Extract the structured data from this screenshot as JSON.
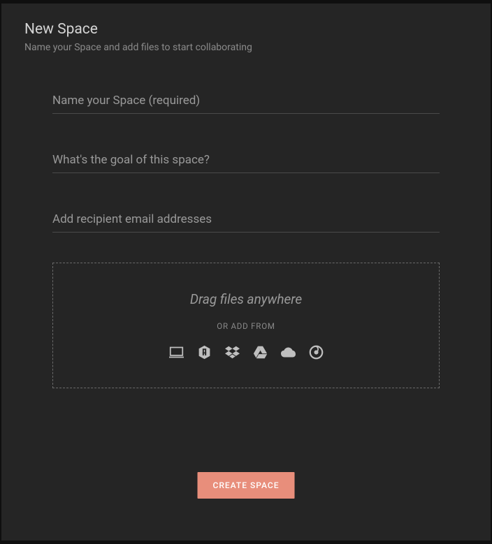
{
  "header": {
    "title": "New Space",
    "subtitle": "Name your Space and add files to start collaborating"
  },
  "form": {
    "name_placeholder": "Name your Space (required)",
    "goal_placeholder": "What's the goal of this space?",
    "recipients_placeholder": "Add recipient email addresses"
  },
  "dropzone": {
    "drag_text": "Drag files anywhere",
    "or_text": "OR ADD FROM",
    "sources": {
      "computer": "computer",
      "hightail": "hightail",
      "dropbox": "dropbox",
      "googledrive": "google-drive",
      "onedrive": "onedrive",
      "other": "other-source"
    }
  },
  "actions": {
    "create_label": "CREATE SPACE"
  }
}
